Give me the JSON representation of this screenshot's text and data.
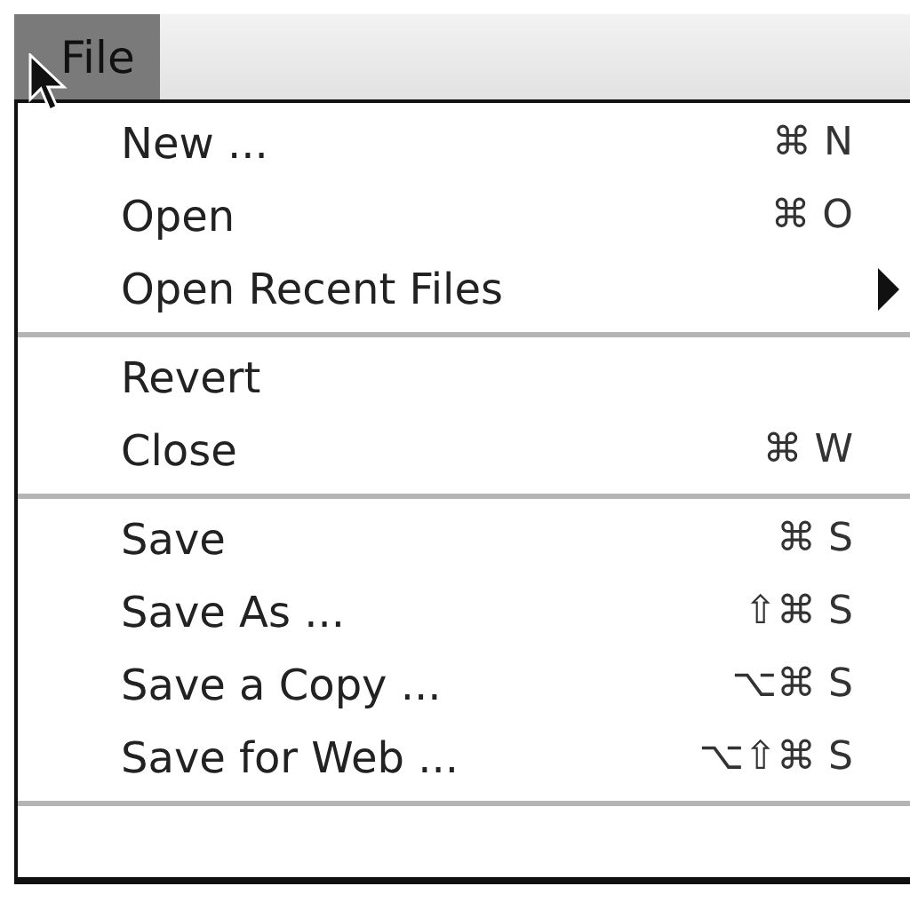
{
  "menubar": {
    "menus": [
      {
        "label": "File",
        "selected": true
      }
    ]
  },
  "menu": {
    "groups": [
      {
        "items": [
          {
            "label": "New ...",
            "shortcut": "⌘ N",
            "submenu": false
          },
          {
            "label": "Open",
            "shortcut": "⌘ O",
            "submenu": false
          },
          {
            "label": "Open Recent Files",
            "submenu": true
          }
        ]
      },
      {
        "items": [
          {
            "label": "Revert",
            "submenu": false
          },
          {
            "label": "Close",
            "shortcut": "⌘ W",
            "submenu": false
          }
        ]
      },
      {
        "items": [
          {
            "label": "Save",
            "shortcut": "⌘ S",
            "submenu": false
          },
          {
            "label": "Save As ...",
            "shortcut": "⇧⌘ S",
            "submenu": false
          },
          {
            "label": "Save a Copy ...",
            "shortcut": "⌥⌘ S",
            "submenu": false
          },
          {
            "label": "Save for Web ...",
            "shortcut": "⌥⇧⌘ S",
            "submenu": false
          }
        ]
      }
    ]
  }
}
